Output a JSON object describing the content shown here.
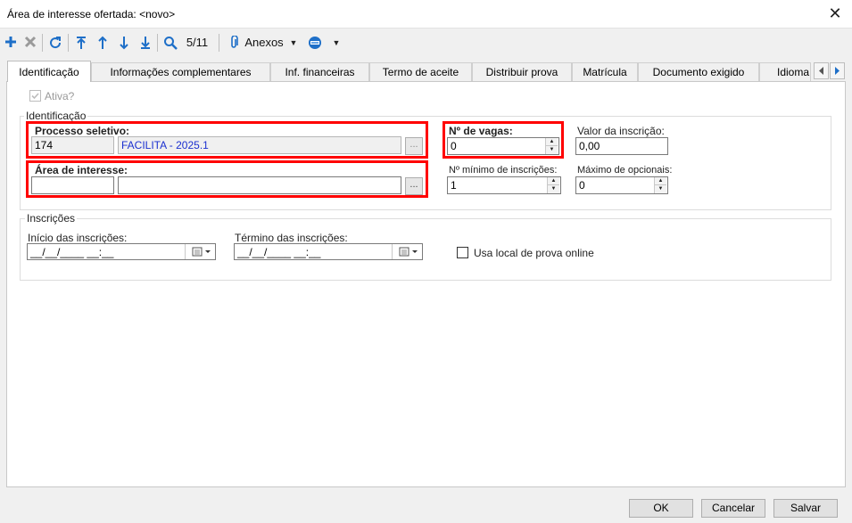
{
  "window": {
    "title": "Área de interesse ofertada: <novo>",
    "close_glyph": "✕"
  },
  "toolbar": {
    "icons": [
      "add-icon",
      "delete-icon",
      "refresh-icon",
      "first-record-icon",
      "previous-record-icon",
      "next-record-icon",
      "last-record-icon",
      "search-icon"
    ],
    "record_position": "5/11",
    "attachments_label": "Anexos",
    "accent_color": "#1e6fc8"
  },
  "tabs": [
    {
      "label": "Identificação",
      "active": true
    },
    {
      "label": "Informações complementares",
      "active": false
    },
    {
      "label": "Inf. financeiras",
      "active": false
    },
    {
      "label": "Termo de aceite",
      "active": false
    },
    {
      "label": "Distribuir prova",
      "active": false
    },
    {
      "label": "Matrícula",
      "active": false
    },
    {
      "label": "Documento exigido",
      "active": false
    },
    {
      "label": "Idioma",
      "active": false
    }
  ],
  "form": {
    "ativa_label": "Ativa?",
    "identificacao": {
      "group_label": "Identificação",
      "processo_label": "Processo seletivo:",
      "processo_code": "174",
      "processo_name": "FACILITA - 2025.1",
      "area_label": "Área de interesse:",
      "area_code": "",
      "area_name": "",
      "lookup_button": "...",
      "vagas_label": "Nº de vagas:",
      "vagas_value": "0",
      "valor_label": "Valor da inscrição:",
      "valor_value": "0,00",
      "min_label": "Nº mínimo de inscrições:",
      "min_value": "1",
      "max_label": "Máximo de opcionais:",
      "max_value": "0"
    },
    "inscricoes": {
      "group_label": "Inscrições",
      "inicio_label": "Início das inscrições:",
      "inicio_value": "__/__/____ __:__",
      "termino_label": "Término das inscrições:",
      "termino_value": "__/__/____ __:__",
      "online_label": "Usa local de prova online"
    }
  },
  "footer": {
    "ok_label": "OK",
    "cancel_label": "Cancelar",
    "save_label": "Salvar"
  },
  "colors": {
    "highlight": "#ff0000",
    "link_text": "#1a2fd0"
  }
}
